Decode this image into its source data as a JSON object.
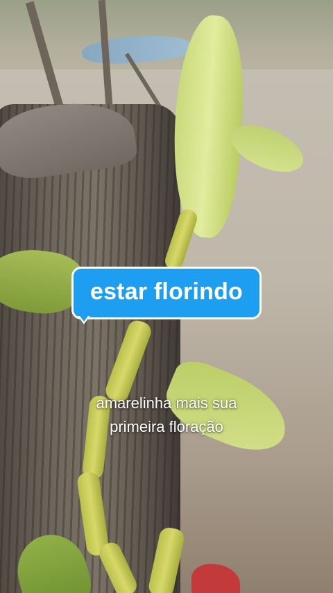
{
  "sticker": {
    "text": "estar florindo",
    "background_color": "#1e9ef0",
    "border_color": "#ffffff",
    "text_color": "#ffffff"
  },
  "caption": {
    "line1": "amarelinha mais sua",
    "line2": "primeira floração",
    "text_color": "#ffffff"
  }
}
